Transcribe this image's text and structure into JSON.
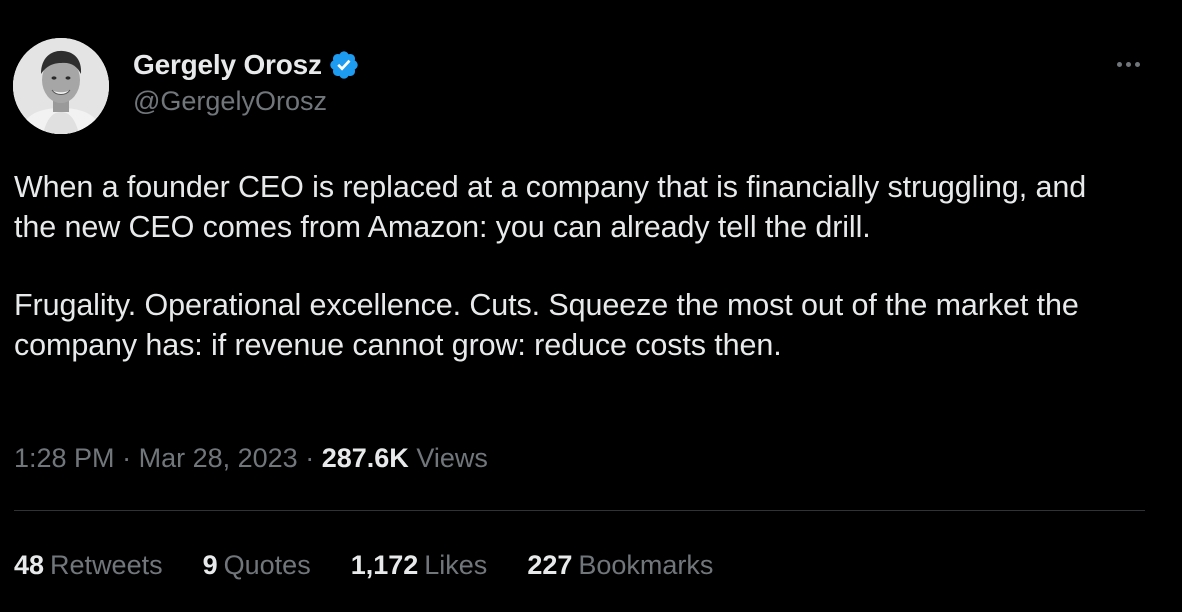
{
  "author": {
    "display_name": "Gergely Orosz",
    "handle": "@GergelyOrosz",
    "verified": true,
    "verified_badge_color": "#1d9bf0",
    "avatar_icon": "profile-photo",
    "more_icon": "more-horizontal-icon"
  },
  "tweet": {
    "paragraph_1": "When a founder CEO is replaced at a company that is financially struggling, and the new CEO comes from Amazon: you can already tell the drill.",
    "paragraph_2": "Frugality. Operational excellence. Cuts. Squeeze the most out of the market the company has: if revenue cannot grow: reduce costs then."
  },
  "meta": {
    "time": "1:28 PM",
    "separator": "·",
    "date": "Mar 28, 2023",
    "views_count": "287.6K",
    "views_label": "Views"
  },
  "stats": {
    "retweets_count": "48",
    "retweets_label": "Retweets",
    "quotes_count": "9",
    "quotes_label": "Quotes",
    "likes_count": "1,172",
    "likes_label": "Likes",
    "bookmarks_count": "227",
    "bookmarks_label": "Bookmarks"
  },
  "colors": {
    "background": "#000000",
    "primary_text": "#e7e9ea",
    "secondary_text": "#71767b",
    "divider": "#2f3336"
  }
}
